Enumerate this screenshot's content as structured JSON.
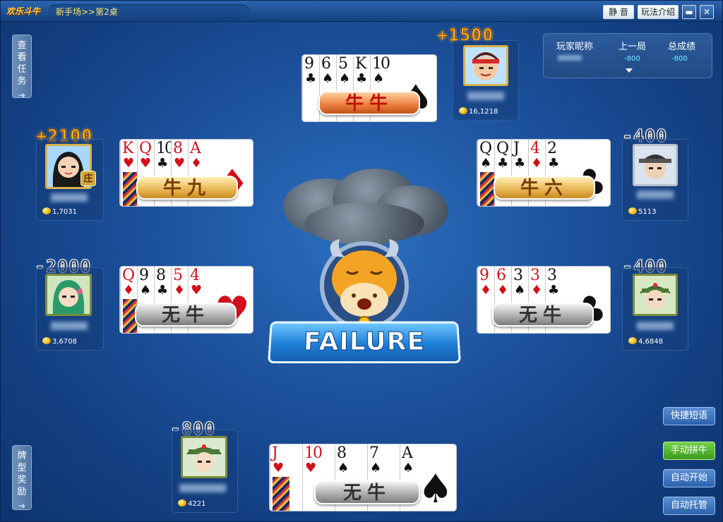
{
  "window": {
    "logo": "欢乐斗牛",
    "breadcrumb": "新手场>>第2桌",
    "buttons": {
      "mute": "静 音",
      "rules": "玩法介绍",
      "minimize": "▬",
      "close": "✕"
    }
  },
  "side_tabs": {
    "tasks": "查看任务",
    "rewards": "牌型奖励",
    "arrow": "➔"
  },
  "scoreboard": {
    "headers": [
      "玩家昵称",
      "上一局",
      "总成绩"
    ],
    "last_round": "-800",
    "total": "-800"
  },
  "players": {
    "top": {
      "score": "+1500",
      "coins": "16,1218",
      "hand_type": "牛牛",
      "cards": [
        {
          "rank": "9",
          "suit": "♣",
          "color": "blk"
        },
        {
          "rank": "6",
          "suit": "♠",
          "color": "blk"
        },
        {
          "rank": "5",
          "suit": "♠",
          "color": "blk"
        },
        {
          "rank": "K",
          "suit": "♣",
          "color": "blk"
        },
        {
          "rank": "10",
          "suit": "♠",
          "color": "blk"
        }
      ]
    },
    "left_upper": {
      "score": "+2100",
      "coins": "1,7031",
      "hand_type": "牛九",
      "dealer": "庄",
      "cards": [
        {
          "rank": "K",
          "suit": "♥",
          "color": "red"
        },
        {
          "rank": "Q",
          "suit": "♥",
          "color": "red"
        },
        {
          "rank": "10",
          "suit": "♣",
          "color": "blk"
        },
        {
          "rank": "8",
          "suit": "♥",
          "color": "red"
        },
        {
          "rank": "A",
          "suit": "♦",
          "color": "red"
        }
      ]
    },
    "right_upper": {
      "score": "-400",
      "coins": "5113",
      "hand_type": "牛六",
      "cards": [
        {
          "rank": "Q",
          "suit": "♠",
          "color": "blk"
        },
        {
          "rank": "Q",
          "suit": "♣",
          "color": "blk"
        },
        {
          "rank": "J",
          "suit": "♣",
          "color": "blk"
        },
        {
          "rank": "4",
          "suit": "♦",
          "color": "red"
        },
        {
          "rank": "2",
          "suit": "♣",
          "color": "blk"
        }
      ]
    },
    "left_lower": {
      "score": "-2000",
      "coins": "3,6708",
      "hand_type": "无牛",
      "cards": [
        {
          "rank": "Q",
          "suit": "♦",
          "color": "red"
        },
        {
          "rank": "9",
          "suit": "♠",
          "color": "blk"
        },
        {
          "rank": "8",
          "suit": "♣",
          "color": "blk"
        },
        {
          "rank": "5",
          "suit": "♦",
          "color": "red"
        },
        {
          "rank": "4",
          "suit": "♥",
          "color": "red"
        }
      ]
    },
    "right_lower": {
      "score": "-400",
      "coins": "4,6848",
      "hand_type": "无牛",
      "cards": [
        {
          "rank": "9",
          "suit": "♦",
          "color": "red"
        },
        {
          "rank": "6",
          "suit": "♦",
          "color": "red"
        },
        {
          "rank": "3",
          "suit": "♠",
          "color": "blk"
        },
        {
          "rank": "3",
          "suit": "♦",
          "color": "red"
        },
        {
          "rank": "3",
          "suit": "♣",
          "color": "blk"
        }
      ]
    },
    "self": {
      "score": "-800",
      "coins": "4221",
      "hand_type": "无牛",
      "cards": [
        {
          "rank": "J",
          "suit": "♥",
          "color": "red"
        },
        {
          "rank": "10",
          "suit": "♥",
          "color": "red"
        },
        {
          "rank": "8",
          "suit": "♠",
          "color": "blk"
        },
        {
          "rank": "7",
          "suit": "♠",
          "color": "blk"
        },
        {
          "rank": "A",
          "suit": "♠",
          "color": "blk"
        }
      ]
    }
  },
  "result_banner": "FAILURE",
  "actions": {
    "quick_chat": "快捷短语",
    "manual_niu": "手动拼牛",
    "auto_start": "自动开始",
    "auto_play": "自动托管"
  },
  "colors": {
    "accent_gold": "#ffb21e",
    "table_blue": "#1b4f99",
    "button_green": "#3b9a1e"
  }
}
